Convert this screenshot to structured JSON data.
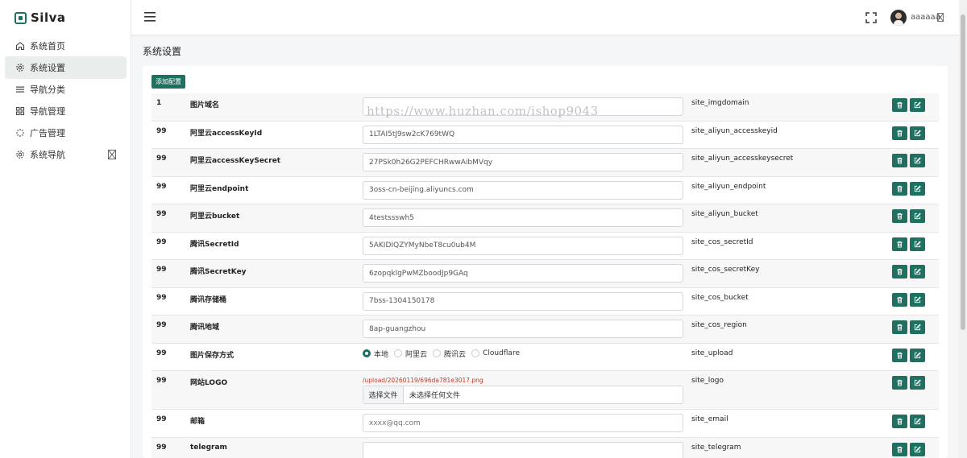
{
  "brand": {
    "name": "Silva",
    "color": "#1f7060"
  },
  "sidebar": {
    "items": [
      {
        "label": "系统首页",
        "icon": "home-icon"
      },
      {
        "label": "系统设置",
        "icon": "gear-icon",
        "active": true
      },
      {
        "label": "导航分类",
        "icon": "list-icon"
      },
      {
        "label": "导航管理",
        "icon": "grid-icon"
      },
      {
        "label": "广告管理",
        "icon": "loader-icon"
      },
      {
        "label": "系统导航",
        "icon": "gear-icon",
        "has_caret": true
      }
    ]
  },
  "header": {
    "username": "aaaaaa"
  },
  "page": {
    "title": "系统设置",
    "add_button": "添加配置"
  },
  "rows": [
    {
      "sort": "1",
      "label": "图片域名",
      "type": "text",
      "value": "",
      "key": "site_imgdomain"
    },
    {
      "sort": "99",
      "label": "阿里云accessKeyId",
      "type": "text",
      "value": "1LTAI5tJ9sw2cK769tWQ",
      "key": "site_aliyun_accesskeyid"
    },
    {
      "sort": "99",
      "label": "阿里云accessKeySecret",
      "type": "text",
      "value": "27PSk0h26G2PEFCHRwwAibMVqy",
      "key": "site_aliyun_accesskeysecret"
    },
    {
      "sort": "99",
      "label": "阿里云endpoint",
      "type": "text",
      "value": "3oss-cn-beijing.aliyuncs.com",
      "key": "site_aliyun_endpoint"
    },
    {
      "sort": "99",
      "label": "阿里云bucket",
      "type": "text",
      "value": "4testssswh5",
      "key": "site_aliyun_bucket"
    },
    {
      "sort": "99",
      "label": "腾讯SecretId",
      "type": "text",
      "value": "5AKIDIQZYMyNbeT8cu0ub4M",
      "key": "site_cos_secretId"
    },
    {
      "sort": "99",
      "label": "腾讯SecretKey",
      "type": "text",
      "value": "6zopqklgPwMZboodJp9GAq",
      "key": "site_cos_secretKey"
    },
    {
      "sort": "99",
      "label": "腾讯存储桶",
      "type": "text",
      "value": "7bss-1304150178",
      "key": "site_cos_bucket"
    },
    {
      "sort": "99",
      "label": "腾讯地域",
      "type": "text",
      "value": "8ap-guangzhou",
      "key": "site_cos_region"
    },
    {
      "sort": "99",
      "label": "图片保存方式",
      "type": "radio",
      "options": [
        "本地",
        "阿里云",
        "腾讯云",
        "Cloudflare"
      ],
      "selected": "本地",
      "key": "site_upload"
    },
    {
      "sort": "99",
      "label": "网站LOGO",
      "type": "file",
      "path": "/upload/20260119/696da781e3017.png",
      "file_button": "选择文件",
      "file_text": "未选择任何文件",
      "key": "site_logo"
    },
    {
      "sort": "99",
      "label": "邮箱",
      "type": "text",
      "value": "",
      "placeholder": "xxxx@qq.com",
      "key": "site_email"
    },
    {
      "sort": "99",
      "label": "telegram",
      "type": "text",
      "value": "",
      "key": "site_telegram"
    }
  ],
  "watermark": "https://www.huzhan.com/ishop9043"
}
